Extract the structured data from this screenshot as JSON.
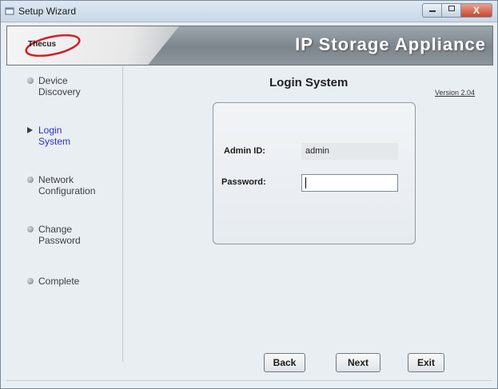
{
  "window": {
    "title": "Setup Wizard",
    "close_label": "X"
  },
  "banner": {
    "logo_text": "Thecus",
    "title": "IP Storage Appliance"
  },
  "sidebar": {
    "steps": [
      {
        "line1": "Device",
        "line2": "Discovery"
      },
      {
        "line1": "Login",
        "line2": "System"
      },
      {
        "line1": "Network",
        "line2": "Configuration"
      },
      {
        "line1": "Change",
        "line2": "Password"
      },
      {
        "line1": "Complete",
        "line2": ""
      }
    ],
    "active_step": 1
  },
  "main": {
    "heading": "Login System",
    "version": "Version 2.04",
    "admin_id_label": "Admin ID:",
    "admin_id_value": "admin",
    "password_label": "Password:",
    "password_value": ""
  },
  "buttons": {
    "back": "Back",
    "next": "Next",
    "exit": "Exit"
  },
  "colors": {
    "active_step": "#2c2fc4",
    "banner_text": "#ffffff"
  }
}
